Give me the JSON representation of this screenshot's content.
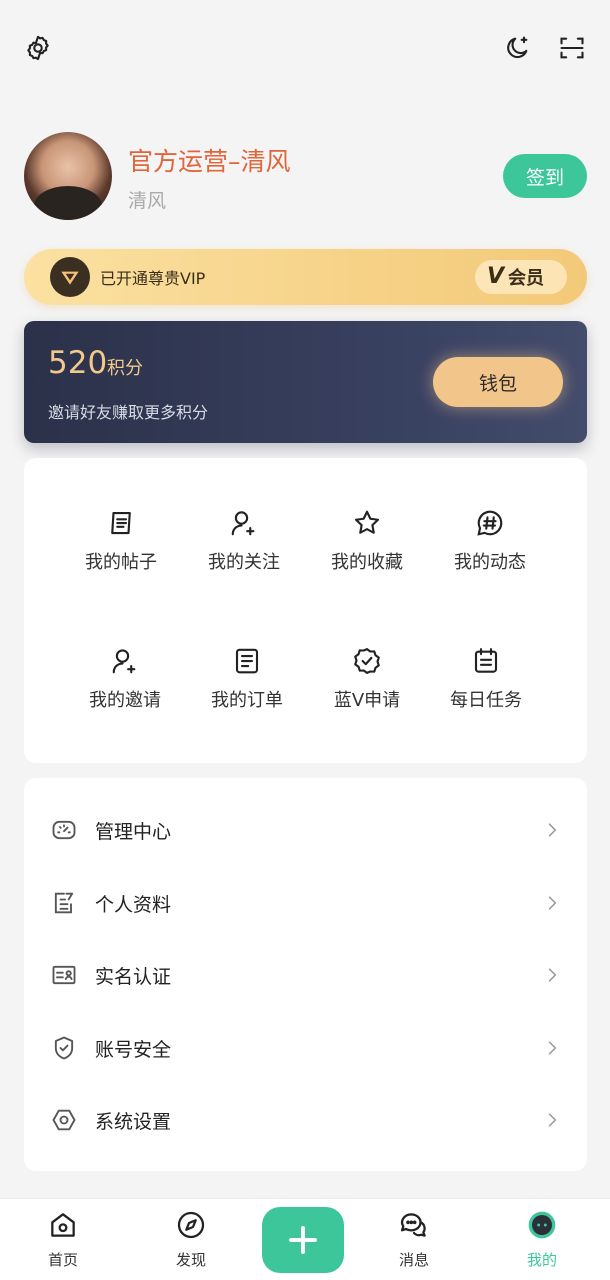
{
  "topbar": {
    "settings_icon": "gear-icon",
    "theme_icon": "moon-icon",
    "scan_icon": "scan-icon"
  },
  "profile": {
    "name": "官方运营–清风",
    "subname": "清风",
    "checkin_label": "签到",
    "accent": "#3ec69b",
    "name_color": "#e0653a"
  },
  "vip": {
    "text": "已开通尊贵VIP",
    "badge_v": "V",
    "badge_label": "会员"
  },
  "points": {
    "value": "520",
    "unit": "积分",
    "tip": "邀请好友赚取更多积分",
    "wallet_label": "钱包"
  },
  "grid": [
    {
      "label": "我的帖子",
      "icon": "post-icon"
    },
    {
      "label": "我的关注",
      "icon": "user-follow-icon"
    },
    {
      "label": "我的收藏",
      "icon": "star-icon"
    },
    {
      "label": "我的动态",
      "icon": "hashtag-icon"
    },
    {
      "label": "我的邀请",
      "icon": "user-invite-icon"
    },
    {
      "label": "我的订单",
      "icon": "order-icon"
    },
    {
      "label": "蓝V申请",
      "icon": "verified-badge-icon"
    },
    {
      "label": "每日任务",
      "icon": "calendar-task-icon"
    }
  ],
  "menu": [
    {
      "label": "管理中心",
      "icon": "dashboard-icon"
    },
    {
      "label": "个人资料",
      "icon": "edit-profile-icon"
    },
    {
      "label": "实名认证",
      "icon": "id-card-icon"
    },
    {
      "label": "账号安全",
      "icon": "shield-icon"
    },
    {
      "label": "系统设置",
      "icon": "settings-hex-icon"
    }
  ],
  "nav": {
    "home": "首页",
    "discover": "发现",
    "messages": "消息",
    "mine": "我的",
    "active": "mine"
  }
}
